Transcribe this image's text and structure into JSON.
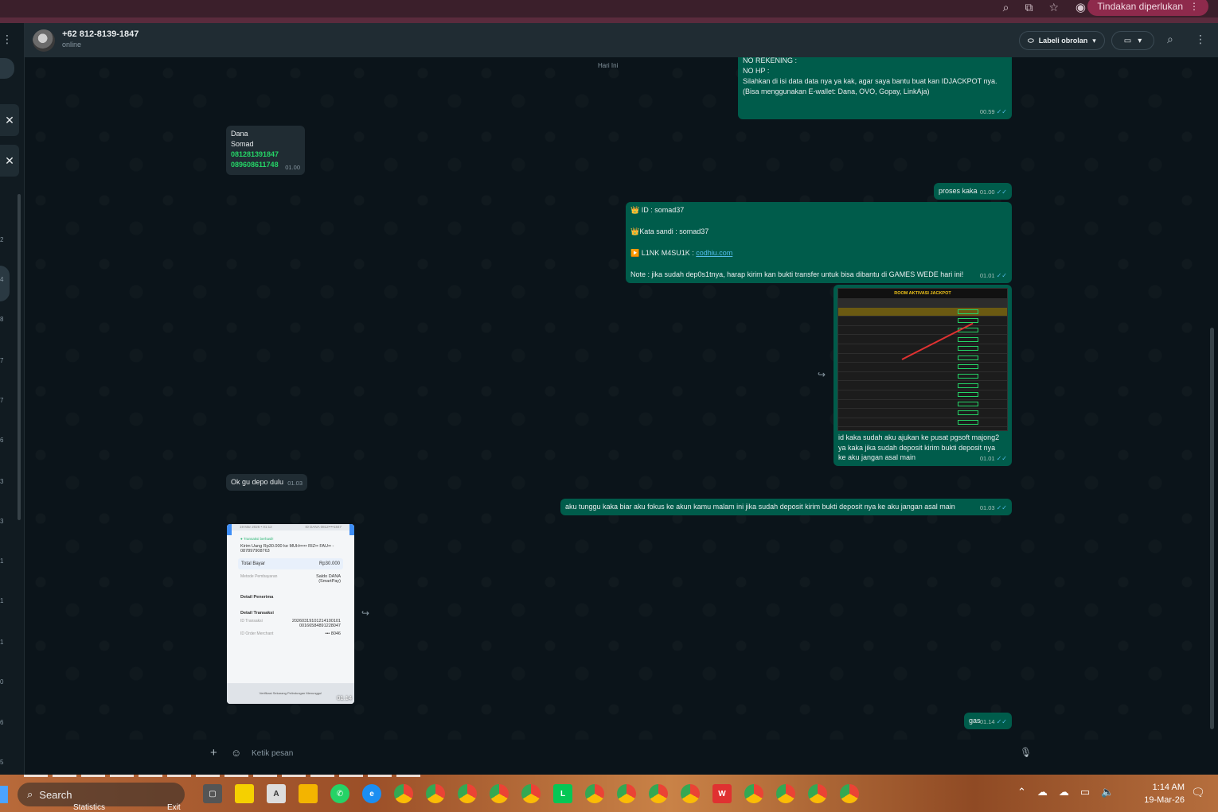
{
  "browser": {
    "action_label": "Tindakan diperlukan"
  },
  "sidebar": {
    "numbers": [
      "2",
      "4",
      "8",
      "7",
      "7",
      "6",
      "3",
      "3",
      "1",
      "1",
      "1",
      "0",
      "6",
      "5"
    ]
  },
  "header": {
    "contact_name": "+62 812-8139-1847",
    "contact_status": "online",
    "label_button": "Labeli obrolan"
  },
  "chat": {
    "day_chip": "Hari Ini",
    "msg1": {
      "lines": [
        "NO REKENING :",
        "NO HP :",
        "",
        "",
        "Silahkan di isi data data nya ya kak, agar saya bantu buat kan IDJACKPOT nya.",
        "(Bisa menggunakan E-wallet: Dana, OVO, Gopay, LinkAja)"
      ],
      "time": "00.59"
    },
    "msg2": {
      "line1": "Dana",
      "line2": "Somad",
      "phone1": "081281391847",
      "phone2": "089608611748",
      "time": "01.00"
    },
    "msg3": {
      "text": "proses kaka",
      "time": "01.00"
    },
    "msg4": {
      "id_line": "👑 ID :  somad37",
      "pass_line": "👑Kata sandi : somad37",
      "link_label": "▶️ L1NK M4SU1K : ",
      "link_text": "codhiu.com",
      "note": "Note : jika sudah dep0s1tnya, harap kirim kan bukti transfer untuk bisa dibantu di GAMES WEDE hari ini!",
      "time": "01.01"
    },
    "msg5": {
      "image_title": "ROOM AKTIVASI JACKPOT",
      "caption_lines": [
        "id kaka sudah aku ajukan ke pusat pgsoft majong2",
        "ya kaka jika sudah deposit kirim bukti deposit nya",
        "ke aku jangan asal main"
      ],
      "time": "01.01"
    },
    "msg6": {
      "text": "Ok gu depo dulu",
      "time": "01.03"
    },
    "msg7": {
      "text": "aku tunggu kaka biar aku fokus ke akun kamu malam ini jika sudah deposit kirim bukti deposit nya ke aku jangan asal main",
      "time": "01.03"
    },
    "receipt": {
      "date": "19 Mar 2026 • 01:12",
      "id": "ID DANA 0812••••1847",
      "success": "Transaksi berhasil!",
      "desc": "Kirim Uang Rp30.000 ke MUH••••• RIZ•• FAU•• - 087897908763",
      "total_label": "Total Bayar",
      "total_value": "Rp30.000",
      "method_label": "Metode Pembayaran",
      "method_value": "Saldo DANA (SmartPay)",
      "recipient": "Detail Penerima",
      "trx_detail": "Detail Transaksi",
      "trx_label": "ID Transaksi",
      "trx_value": "2026031910121410010100166584891228047",
      "order_label": "ID Order Merchant",
      "order_value": "••• 8046",
      "footer": "Verifikasi Sekarang Pelindungan Menunggu!",
      "time": "01.14"
    },
    "msg8": {
      "text": "gas",
      "time": "01.14"
    }
  },
  "composer": {
    "placeholder": "Ketik pesan"
  },
  "taskbar": {
    "search": "Search",
    "statistics": "Statistics",
    "exit": "Exit",
    "time": "1:14 AM",
    "date": "19-Mar-26"
  }
}
